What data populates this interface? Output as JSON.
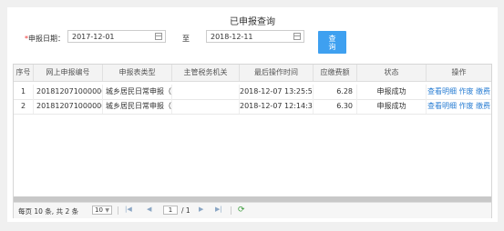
{
  "title": "已申报查询",
  "form": {
    "required_mark": "*",
    "date_label": "申报日期：",
    "start_date": "2017-12-01",
    "to_label": "至",
    "end_date": "2018-12-11",
    "query_label_line1": "查",
    "query_label_line2": "询"
  },
  "table": {
    "columns": [
      "序号",
      "网上申报编号",
      "申报表类型",
      "主管税务机关",
      "最后操作时间",
      "应缴费额",
      "状态",
      "操作"
    ],
    "rows": [
      {
        "index": "1",
        "number": "201812071000000...",
        "type": "城乡居民日常申报（...",
        "authority": "",
        "time": "2018-12-07 13:25:57",
        "amount": "6.28",
        "status": "申报成功",
        "actions": [
          "查看明细",
          "作废",
          "缴费"
        ]
      },
      {
        "index": "2",
        "number": "201812071000000...",
        "type": "城乡居民日常申报（...",
        "authority": "",
        "time": "2018-12-07 12:14:34",
        "amount": "6.30",
        "status": "申报成功",
        "actions": [
          "查看明细",
          "作废",
          "缴费"
        ]
      }
    ]
  },
  "pager": {
    "summary": "每页 10 条, 共 2 条",
    "page_size": "10",
    "first": "|◀",
    "prev": "◀",
    "page_input": "1",
    "page_total": "/ 1",
    "next": "▶",
    "last": "▶|",
    "refresh": "⟳"
  },
  "colors": {
    "accent": "#3ea0f0",
    "link": "#2a7ed3",
    "required": "#e33333"
  }
}
